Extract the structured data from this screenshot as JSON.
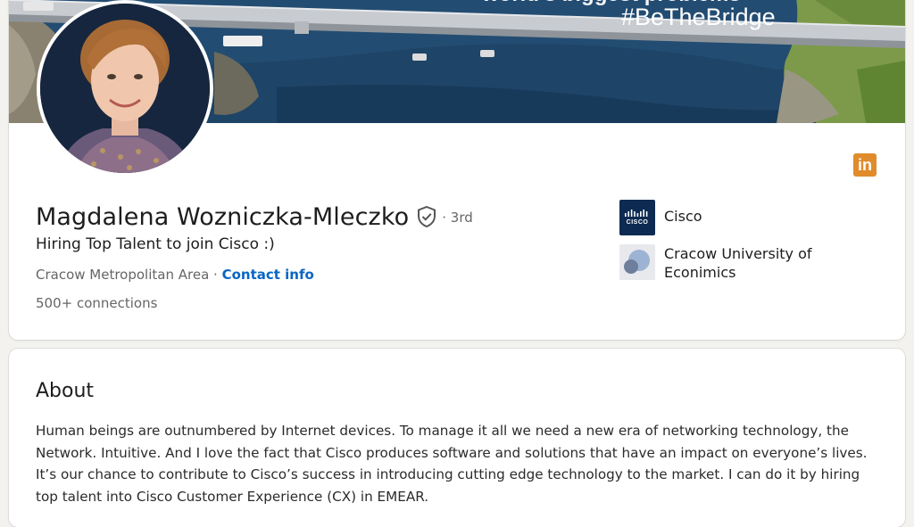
{
  "banner": {
    "headline_partial": "world's biggest problems",
    "hashtag": "#BeTheBridge"
  },
  "profile": {
    "name": "Magdalena Wozniczka-Mleczko",
    "degree": "· 3rd",
    "headline": "Hiring Top Talent to join Cisco :)",
    "location": "Cracow Metropolitan Area",
    "separator": " · ",
    "contact_info": "Contact info",
    "connections": "500+ connections"
  },
  "organizations": [
    {
      "name": "Cisco",
      "logo_text": "CISCO"
    },
    {
      "name": "Cracow University of Econimics"
    }
  ],
  "about": {
    "title": "About",
    "text": "Human beings are outnumbered by Internet devices. To manage it all we need a new era of networking technology, the Network. Intuitive. And I love the fact that Cisco produces software and solutions that have an impact on everyone’s lives. It’s our chance to contribute to Cisco’s success in introducing cutting edge technology to the market. I can do it by hiring top talent into Cisco Customer Experience (CX) in EMEAR."
  },
  "icons": {
    "linkedin": "linkedin-icon",
    "verified": "verified-shield-icon"
  },
  "colors": {
    "link": "#0a66c2",
    "linkedin_badge": "#e08b2c",
    "cisco_logo_bg": "#0d2a52"
  }
}
